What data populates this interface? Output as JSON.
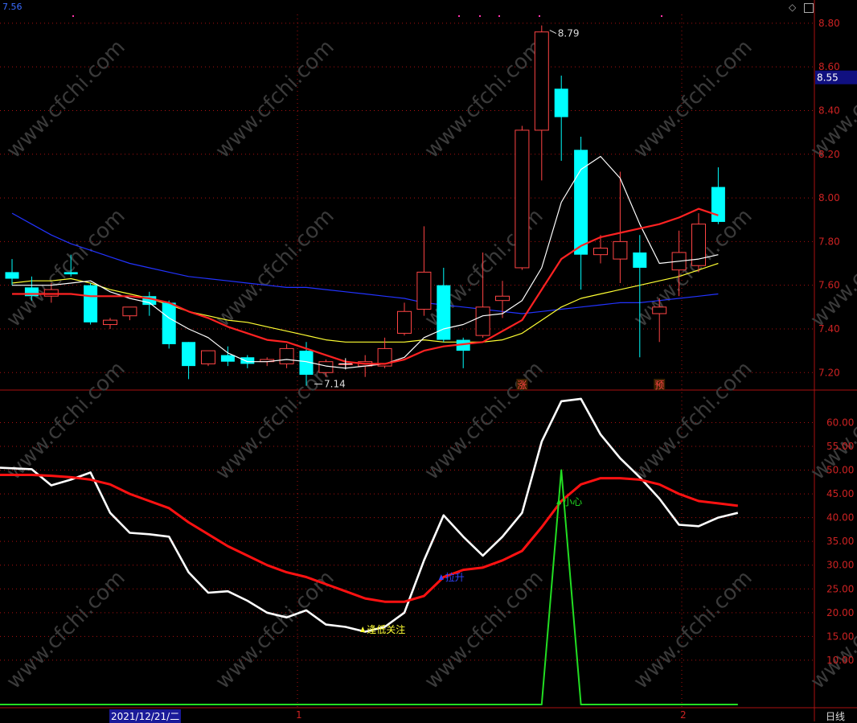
{
  "header": {
    "top_left_value": "7.56"
  },
  "controls": {
    "diamond_icon": "diamond-icon",
    "panel_icon": "panel-toggle-icon"
  },
  "price_panel": {
    "y_ticks": [
      "8.80",
      "8.60",
      "8.40",
      "8.20",
      "8.00",
      "7.80",
      "7.60",
      "7.40",
      "7.20"
    ],
    "current_price_label": "8.55",
    "high_label": "8.79",
    "low_label": "7.14",
    "markers": [
      {
        "text": "涨",
        "at_index": 26
      },
      {
        "text": "预",
        "at_index": 33
      }
    ]
  },
  "indicator_panel": {
    "y_ticks": [
      "60.00",
      "55.00",
      "50.00",
      "45.00",
      "40.00",
      "35.00",
      "30.00",
      "25.00",
      "20.00",
      "15.00",
      "10.00"
    ],
    "annotations": [
      {
        "text": "逢低关注",
        "at_index": 18,
        "color": "#ffff33"
      },
      {
        "text": "拉升",
        "at_index": 22,
        "color": "#3344ff"
      },
      {
        "text": "小心",
        "at_index": 28,
        "color": "#22dd22"
      }
    ]
  },
  "x_axis": {
    "date_label": "2021/12/21/二",
    "month_labels": [
      "1",
      "2"
    ]
  },
  "period_label": "日线",
  "colors": {
    "up": "#ff4444",
    "down": "#00ffff",
    "ma5": "#ffffff",
    "ma10": "#ff2222",
    "ma20": "#ffff33",
    "ma60": "#2233ff",
    "grid": "#aa1111",
    "osc_fast": "#ffffff",
    "osc_slow": "#ff1111",
    "osc_signal": "#22dd22"
  },
  "chart_data": [
    {
      "type": "candlestick",
      "ylim": [
        7.12,
        8.84
      ],
      "candles": [
        {
          "o": 7.66,
          "h": 7.72,
          "l": 7.6,
          "c": 7.63
        },
        {
          "o": 7.59,
          "h": 7.64,
          "l": 7.53,
          "c": 7.55
        },
        {
          "o": 7.55,
          "h": 7.61,
          "l": 7.52,
          "c": 7.58
        },
        {
          "o": 7.66,
          "h": 7.74,
          "l": 7.64,
          "c": 7.65
        },
        {
          "o": 7.6,
          "h": 7.61,
          "l": 7.42,
          "c": 7.43
        },
        {
          "o": 7.42,
          "h": 7.45,
          "l": 7.4,
          "c": 7.44
        },
        {
          "o": 7.46,
          "h": 7.5,
          "l": 7.44,
          "c": 7.5
        },
        {
          "o": 7.55,
          "h": 7.57,
          "l": 7.46,
          "c": 7.51
        },
        {
          "o": 7.52,
          "h": 7.53,
          "l": 7.31,
          "c": 7.33
        },
        {
          "o": 7.34,
          "h": 7.34,
          "l": 7.17,
          "c": 7.23
        },
        {
          "o": 7.24,
          "h": 7.3,
          "l": 7.23,
          "c": 7.3
        },
        {
          "o": 7.28,
          "h": 7.32,
          "l": 7.23,
          "c": 7.25
        },
        {
          "o": 7.27,
          "h": 7.28,
          "l": 7.22,
          "c": 7.24
        },
        {
          "o": 7.25,
          "h": 7.27,
          "l": 7.23,
          "c": 7.26
        },
        {
          "o": 7.24,
          "h": 7.33,
          "l": 7.22,
          "c": 7.31
        },
        {
          "o": 7.3,
          "h": 7.34,
          "l": 7.14,
          "c": 7.19
        },
        {
          "o": 7.2,
          "h": 7.26,
          "l": 7.18,
          "c": 7.25
        },
        {
          "o": 7.24,
          "h": 7.25,
          "l": 7.22,
          "c": 7.24
        },
        {
          "o": 7.23,
          "h": 7.28,
          "l": 7.18,
          "c": 7.25
        },
        {
          "o": 7.23,
          "h": 7.36,
          "l": 7.22,
          "c": 7.31
        },
        {
          "o": 7.38,
          "h": 7.52,
          "l": 7.37,
          "c": 7.48
        },
        {
          "o": 7.49,
          "h": 7.87,
          "l": 7.46,
          "c": 7.66
        },
        {
          "o": 7.6,
          "h": 7.68,
          "l": 7.34,
          "c": 7.35
        },
        {
          "o": 7.35,
          "h": 7.36,
          "l": 7.22,
          "c": 7.3
        },
        {
          "o": 7.37,
          "h": 7.75,
          "l": 7.36,
          "c": 7.5
        },
        {
          "o": 7.53,
          "h": 7.62,
          "l": 7.45,
          "c": 7.55
        },
        {
          "o": 7.68,
          "h": 8.33,
          "l": 7.67,
          "c": 8.31
        },
        {
          "o": 8.31,
          "h": 8.79,
          "l": 8.08,
          "c": 8.76
        },
        {
          "o": 8.5,
          "h": 8.56,
          "l": 8.17,
          "c": 8.37
        },
        {
          "o": 8.22,
          "h": 8.28,
          "l": 7.58,
          "c": 7.74
        },
        {
          "o": 7.74,
          "h": 7.83,
          "l": 7.7,
          "c": 7.77
        },
        {
          "o": 7.72,
          "h": 8.12,
          "l": 7.61,
          "c": 7.8
        },
        {
          "o": 7.75,
          "h": 7.83,
          "l": 7.27,
          "c": 7.68
        },
        {
          "o": 7.47,
          "h": 7.54,
          "l": 7.34,
          "c": 7.5
        },
        {
          "o": 7.67,
          "h": 7.85,
          "l": 7.55,
          "c": 7.75
        },
        {
          "o": 7.69,
          "h": 7.93,
          "l": 7.66,
          "c": 7.88
        },
        {
          "o": 8.05,
          "h": 8.14,
          "l": 7.88,
          "c": 7.89
        }
      ],
      "ma5": [
        7.6,
        7.6,
        7.6,
        7.61,
        7.62,
        7.57,
        7.54,
        7.52,
        7.45,
        7.4,
        7.36,
        7.29,
        7.25,
        7.25,
        7.26,
        7.25,
        7.23,
        7.22,
        7.23,
        7.24,
        7.27,
        7.36,
        7.4,
        7.42,
        7.46,
        7.47,
        7.53,
        7.68,
        7.98,
        8.13,
        8.19,
        8.09,
        7.88,
        7.7,
        7.71,
        7.72,
        7.74
      ],
      "ma10": [
        7.56,
        7.56,
        7.56,
        7.56,
        7.55,
        7.55,
        7.55,
        7.54,
        7.52,
        7.48,
        7.45,
        7.41,
        7.38,
        7.35,
        7.34,
        7.31,
        7.28,
        7.25,
        7.24,
        7.24,
        7.26,
        7.3,
        7.32,
        7.33,
        7.34,
        7.39,
        7.44,
        7.58,
        7.72,
        7.78,
        7.82,
        7.84,
        7.86,
        7.88,
        7.91,
        7.95,
        7.92
      ],
      "ma20": [
        7.61,
        7.62,
        7.62,
        7.63,
        7.61,
        7.58,
        7.56,
        7.54,
        7.51,
        7.48,
        7.46,
        7.44,
        7.43,
        7.41,
        7.39,
        7.37,
        7.35,
        7.34,
        7.34,
        7.34,
        7.34,
        7.35,
        7.34,
        7.34,
        7.34,
        7.35,
        7.38,
        7.44,
        7.5,
        7.54,
        7.56,
        7.58,
        7.6,
        7.62,
        7.64,
        7.67,
        7.7
      ],
      "ma60": [
        7.93,
        7.88,
        7.83,
        7.79,
        7.76,
        7.73,
        7.7,
        7.68,
        7.66,
        7.64,
        7.63,
        7.62,
        7.61,
        7.6,
        7.59,
        7.59,
        7.58,
        7.57,
        7.56,
        7.55,
        7.54,
        7.52,
        7.51,
        7.5,
        7.49,
        7.48,
        7.47,
        7.48,
        7.49,
        7.5,
        7.51,
        7.52,
        7.52,
        7.53,
        7.54,
        7.55,
        7.56
      ]
    },
    {
      "type": "line",
      "ylim": [
        0,
        66
      ],
      "series": [
        {
          "values": [
            50.5,
            50.2,
            46.8,
            48.0,
            49.5,
            41.0,
            36.8,
            36.5,
            36.0,
            28.5,
            24.2,
            24.5,
            22.5,
            20.0,
            19.0,
            20.5,
            17.5,
            17.0,
            16.0,
            17.0,
            20.0,
            31.0,
            40.5,
            36.0,
            32.0,
            36.0,
            41.0,
            56.0,
            64.5,
            65.0,
            57.5,
            52.5,
            48.5,
            44.0,
            38.5,
            38.2,
            40.0,
            41.0
          ]
        },
        {
          "values": [
            49.0,
            49.0,
            48.8,
            48.5,
            48.0,
            47.0,
            45.0,
            43.5,
            42.0,
            39.0,
            36.5,
            34.0,
            32.0,
            30.0,
            28.5,
            27.5,
            26.0,
            24.5,
            23.0,
            22.3,
            22.3,
            23.5,
            27.5,
            29.0,
            29.5,
            31.0,
            33.0,
            38.0,
            43.5,
            47.0,
            48.3,
            48.3,
            48.0,
            47.0,
            45.0,
            43.5,
            43.0,
            42.5
          ]
        },
        {
          "values": [
            0,
            0,
            0,
            0,
            0,
            0,
            0,
            0,
            0,
            0,
            0,
            0,
            0,
            0,
            0,
            0,
            0,
            0,
            0,
            0,
            0,
            0,
            0,
            0,
            0,
            0,
            0,
            0,
            50,
            0,
            0,
            0,
            0,
            0,
            0,
            0,
            0,
            0
          ]
        }
      ]
    }
  ]
}
